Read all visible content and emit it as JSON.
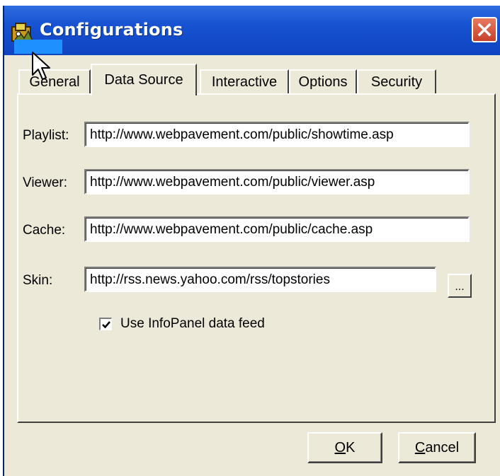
{
  "window": {
    "title": "Configurations"
  },
  "tabs": [
    {
      "label": "General",
      "active": false
    },
    {
      "label": "Data Source",
      "active": true
    },
    {
      "label": "Interactive",
      "active": false
    },
    {
      "label": "Options",
      "active": false
    },
    {
      "label": "Security",
      "active": false
    }
  ],
  "fields": {
    "playlist": {
      "label": "Playlist:",
      "value": "http://www.webpavement.com/public/showtime.asp"
    },
    "viewer": {
      "label": "Viewer:",
      "value": "http://www.webpavement.com/public/viewer.asp"
    },
    "cache": {
      "label": "Cache:",
      "value": "http://www.webpavement.com/public/cache.asp"
    },
    "skin": {
      "label": "Skin:",
      "value": "http://rss.news.yahoo.com/rss/topstories"
    }
  },
  "browse_button": {
    "label": "..."
  },
  "infopanel_checkbox": {
    "label": "Use InfoPanel data feed",
    "checked": true
  },
  "buttons": {
    "ok": {
      "mnemonic": "O",
      "rest": "K"
    },
    "cancel": {
      "mnemonic": "C",
      "rest": "ancel"
    }
  },
  "colors": {
    "titlebar": "#1652d1",
    "dialog_bg": "#ece9d8",
    "close_button": "#c6402a"
  }
}
